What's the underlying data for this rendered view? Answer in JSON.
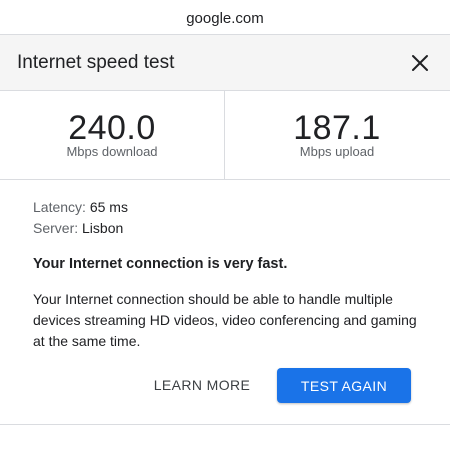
{
  "browser": {
    "url": "google.com"
  },
  "dialog": {
    "title": "Internet speed test",
    "close_icon": "close-icon"
  },
  "metrics": {
    "download": {
      "value": "240.0",
      "unit": "Mbps download"
    },
    "upload": {
      "value": "187.1",
      "unit": "Mbps upload"
    }
  },
  "details": {
    "latency_label": "Latency:",
    "latency_value": "65 ms",
    "server_label": "Server:",
    "server_value": "Lisbon"
  },
  "summary": "Your Internet connection is very fast.",
  "description": "Your Internet connection should be able to handle multiple devices streaming HD videos, video conferencing and gaming at the same time.",
  "actions": {
    "learn_more_label": "LEARN MORE",
    "test_again_label": "TEST AGAIN"
  },
  "colors": {
    "accent": "#1a73e8",
    "header_background": "#f5f5f5",
    "divider": "#dadce0"
  }
}
